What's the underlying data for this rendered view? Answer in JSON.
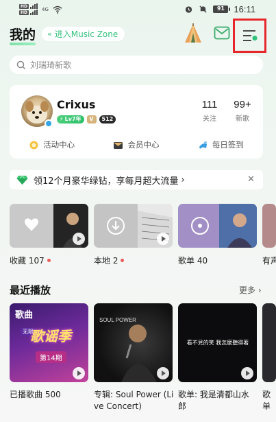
{
  "status_bar": {
    "sim1": "HD",
    "sim2": "HD",
    "network": "4G",
    "battery": "91",
    "time": "16:11"
  },
  "header": {
    "title": "我的",
    "zone_link": "进入Music Zone",
    "icons": [
      "tent-icon",
      "mail-icon",
      "menu-icon"
    ]
  },
  "search": {
    "placeholder": "刘瑞琦新歌"
  },
  "profile": {
    "name": "Crixus",
    "level_badge": "Lv7年",
    "vip_badge": "V",
    "number_badge": "512",
    "stats": {
      "follow_count": "111",
      "follow_label": "关注",
      "new_count": "99+",
      "new_label": "新歌"
    },
    "quick_links": [
      {
        "label": "活动中心",
        "icon": "activity-icon"
      },
      {
        "label": "会员中心",
        "icon": "member-envelope-icon"
      },
      {
        "label": "每日签到",
        "icon": "sign-in-icon"
      }
    ]
  },
  "promo": {
    "text": "领12个月豪华绿钻，享每月超大流量",
    "arrow": "›",
    "close": "✕"
  },
  "shortcuts": [
    {
      "label": "收藏 107",
      "has_dot": true,
      "icon": "heart-icon"
    },
    {
      "label": "本地 2",
      "has_dot": true,
      "icon": "download-icon"
    },
    {
      "label": "歌单 40",
      "has_dot": false,
      "icon": "disc-icon"
    },
    {
      "label": "有声",
      "has_dot": false,
      "icon": ""
    }
  ],
  "recent": {
    "title": "最近播放",
    "more": "更多 ›",
    "items": [
      {
        "label": "已播歌曲 500",
        "cover_text1": "歌曲",
        "cover_text2": "无限",
        "cover_text3": "歌谣季",
        "cover_text4": "第14期"
      },
      {
        "label_line1": "专辑: Soul Power (Li",
        "label_line2": "ve Concert)",
        "cover_text1": "SOUL POWER"
      },
      {
        "label_line1": "歌单: 我是清都山水",
        "label_line2": "郎",
        "cover_text1": "看不見的笑 我怎麼聽得著"
      },
      {
        "label_line1": "歌单",
        "label_line2": ""
      }
    ]
  },
  "colors": {
    "brand_green": "#31c27c",
    "highlight_red": "#e6262b"
  }
}
